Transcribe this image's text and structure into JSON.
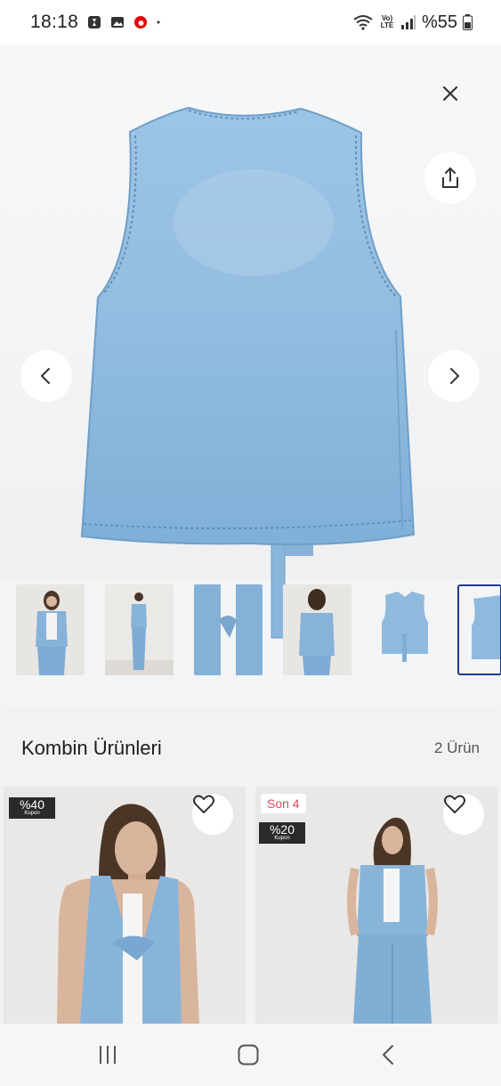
{
  "status_bar": {
    "time": "18:18",
    "left_icons": [
      "whatsapp-icon",
      "gallery-icon",
      "vodafone-icon",
      "dot-icon"
    ],
    "network_label": "Vo) LTE",
    "battery": "%55"
  },
  "gallery": {
    "close_icon": "close-icon",
    "share_icon": "share-icon",
    "prev_icon": "chevron-left-icon",
    "next_icon": "chevron-right-icon",
    "image_count": 6,
    "active_index": 5
  },
  "combine": {
    "title": "Kombin Ürünleri",
    "count": "2 Ürün"
  },
  "products": [
    {
      "coupon_percent": "%40",
      "coupon_label": "Kupon",
      "favorite_icon": "heart-icon"
    },
    {
      "stock_badge": "Son 4",
      "coupon_percent": "%20",
      "coupon_label": "Kupon",
      "favorite_icon": "heart-icon"
    }
  ],
  "colors": {
    "denim": "#8fb9dd",
    "active_border": "#1e3a8a",
    "badge_red": "#e2485b"
  }
}
